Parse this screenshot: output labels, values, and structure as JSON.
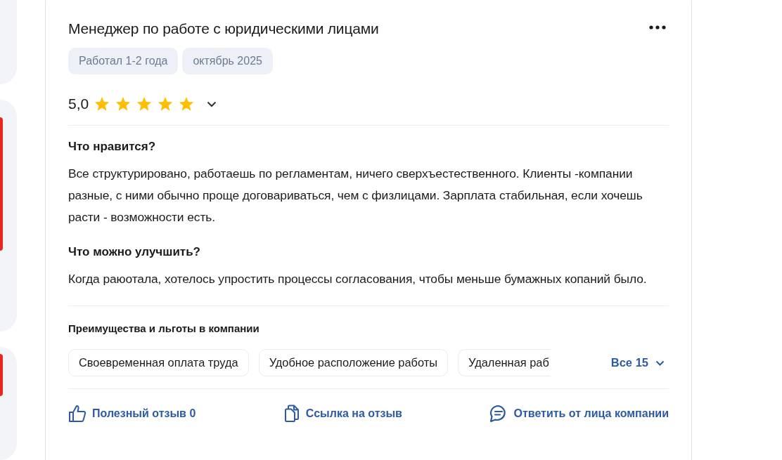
{
  "review": {
    "title": "Менеджер по работе с юридическими лицами",
    "tags": [
      "Работал 1-2 года",
      "октябрь 2025"
    ],
    "rating": {
      "value": "5,0",
      "stars": 5,
      "expanded": false
    },
    "sections": [
      {
        "heading": "Что нравится?",
        "text": "Все структурировано, работаешь по регламентам, ничего сверхъестественного. Клиенты -компании разные, с ними обычно проще договариваться, чем с физлицами. Зарплата стабильная, если хочешь расти - возможности есть."
      },
      {
        "heading": "Что можно улучшить?",
        "text": "Когда раюотала, хотелось упростить процессы согласования, чтобы меньше бумажных копаний было."
      }
    ],
    "benefits": {
      "heading": "Преимущества и льготы в компании",
      "items": [
        "Своевременная оплата труда",
        "Удобное расположение работы",
        "Удаленная раб"
      ],
      "more": "Все 15"
    },
    "actions": [
      {
        "kind": "like",
        "label": "Полезный отзыв 0"
      },
      {
        "kind": "link",
        "label": "Ссылка на отзыв"
      },
      {
        "kind": "reply",
        "label": "Ответить от лица компании"
      }
    ]
  }
}
